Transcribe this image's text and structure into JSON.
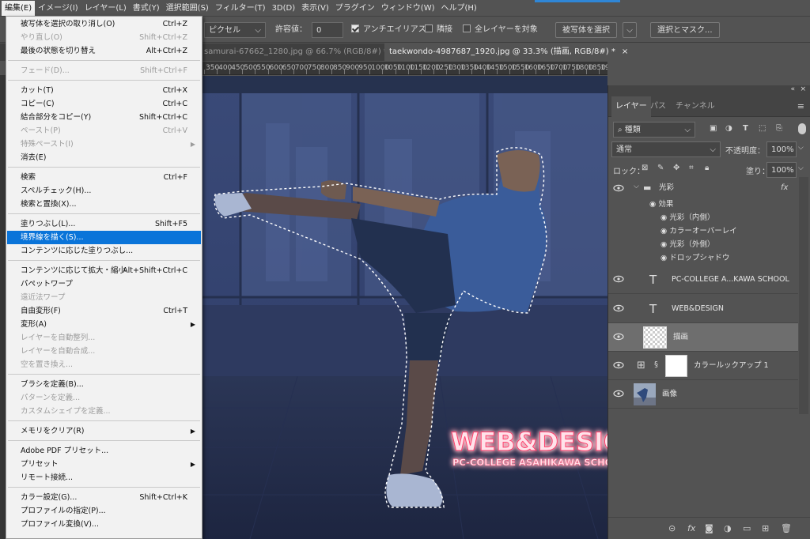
{
  "menubar": {
    "items": [
      "編集(E)",
      "イメージ(I)",
      "レイヤー(L)",
      "書式(Y)",
      "選択範囲(S)",
      "フィルター(T)",
      "3D(D)",
      "表示(V)",
      "プラグイン",
      "ウィンドウ(W)",
      "ヘルプ(H)"
    ]
  },
  "options": {
    "pixel_unit": "ピクセル",
    "tolerance_label": "許容値：",
    "tolerance_value": "0",
    "antialias_label": "アンチエイリアス",
    "contiguous_label": "隣接",
    "all_layers_label": "全レイヤーを対象",
    "select_subject": "被写体を選択",
    "select_mask": "選択とマスク..."
  },
  "tabs": [
    {
      "label": "samurai-67662_1280.jpg @ 66.7% (RGB/8#) *",
      "close": "×"
    },
    {
      "label": "taekwondo-4987687_1920.jpg @ 33.3% (描画, RGB/8#) *",
      "close": "×"
    }
  ],
  "ruler": [
    "350",
    "400",
    "450",
    "500",
    "550",
    "600",
    "650",
    "700",
    "750",
    "800",
    "850",
    "900",
    "950",
    "1000",
    "1050",
    "1100",
    "1150",
    "1200",
    "1250",
    "1300",
    "1350",
    "1400",
    "1450",
    "1500",
    "1550",
    "1600",
    "1650",
    "1700",
    "1750",
    "1800",
    "1850",
    "1900"
  ],
  "canvas": {
    "line1": "WEB&DESIGN",
    "line2": "PC-COLLEGE ASAHIKAWA SCHOOL"
  },
  "edit_menu": {
    "items": [
      {
        "label": "被写体を選択の取り消し(O)",
        "shortcut": "Ctrl+Z",
        "disabled": false
      },
      {
        "label": "やり直し(O)",
        "shortcut": "Shift+Ctrl+Z",
        "disabled": true
      },
      {
        "label": "最後の状態を切り替え",
        "shortcut": "Alt+Ctrl+Z",
        "disabled": false
      },
      {
        "sep": true
      },
      {
        "label": "フェード(D)...",
        "shortcut": "Shift+Ctrl+F",
        "disabled": true
      },
      {
        "sep": true
      },
      {
        "label": "カット(T)",
        "shortcut": "Ctrl+X",
        "disabled": false
      },
      {
        "label": "コピー(C)",
        "shortcut": "Ctrl+C",
        "disabled": false
      },
      {
        "label": "結合部分をコピー(Y)",
        "shortcut": "Shift+Ctrl+C",
        "disabled": false
      },
      {
        "label": "ペースト(P)",
        "shortcut": "Ctrl+V",
        "disabled": true
      },
      {
        "label": "特殊ペースト(I)",
        "shortcut": "",
        "submenu": true,
        "disabled": true
      },
      {
        "label": "消去(E)",
        "shortcut": "",
        "disabled": false
      },
      {
        "sep": true
      },
      {
        "label": "検索",
        "shortcut": "Ctrl+F",
        "disabled": false
      },
      {
        "label": "スペルチェック(H)...",
        "shortcut": "",
        "disabled": false
      },
      {
        "label": "検索と置換(X)...",
        "shortcut": "",
        "disabled": false
      },
      {
        "sep": true
      },
      {
        "label": "塗りつぶし(L)...",
        "shortcut": "Shift+F5",
        "disabled": false
      },
      {
        "label": "境界線を描く(S)...",
        "shortcut": "",
        "disabled": false,
        "highlighted": true
      },
      {
        "label": "コンテンツに応じた塗りつぶし...",
        "shortcut": "",
        "disabled": false
      },
      {
        "sep": true
      },
      {
        "label": "コンテンツに応じて拡大・縮小",
        "shortcut": "Alt+Shift+Ctrl+C",
        "disabled": false
      },
      {
        "label": "パペットワープ",
        "shortcut": "",
        "disabled": false
      },
      {
        "label": "遠近法ワープ",
        "shortcut": "",
        "disabled": true
      },
      {
        "label": "自由変形(F)",
        "shortcut": "Ctrl+T",
        "disabled": false
      },
      {
        "label": "変形(A)",
        "shortcut": "",
        "submenu": true,
        "disabled": false
      },
      {
        "label": "レイヤーを自動整列...",
        "shortcut": "",
        "disabled": true
      },
      {
        "label": "レイヤーを自動合成...",
        "shortcut": "",
        "disabled": true
      },
      {
        "label": "空を置き換え...",
        "shortcut": "",
        "disabled": true
      },
      {
        "sep": true
      },
      {
        "label": "ブラシを定義(B)...",
        "shortcut": "",
        "disabled": false
      },
      {
        "label": "パターンを定義...",
        "shortcut": "",
        "disabled": true
      },
      {
        "label": "カスタムシェイプを定義...",
        "shortcut": "",
        "disabled": true
      },
      {
        "sep": true
      },
      {
        "label": "メモリをクリア(R)",
        "shortcut": "",
        "submenu": true,
        "disabled": false
      },
      {
        "sep": true
      },
      {
        "label": "Adobe PDF プリセット...",
        "shortcut": "",
        "disabled": false
      },
      {
        "label": "プリセット",
        "shortcut": "",
        "submenu": true,
        "disabled": false
      },
      {
        "label": "リモート接続...",
        "shortcut": "",
        "disabled": false
      },
      {
        "sep": true
      },
      {
        "label": "カラー設定(G)...",
        "shortcut": "Shift+Ctrl+K",
        "disabled": false
      },
      {
        "label": "プロファイルの指定(P)...",
        "shortcut": "",
        "disabled": false
      },
      {
        "label": "プロファイル変換(V)...",
        "shortcut": "",
        "disabled": false
      }
    ]
  },
  "layers_panel": {
    "tabs": [
      "レイヤー",
      "パス",
      "チャンネル"
    ],
    "filter_kind": "種類",
    "blend_mode": "通常",
    "opacity_label": "不透明度：",
    "opacity_value": "100%",
    "lock_label": "ロック：",
    "fill_label": "塗り：",
    "fill_value": "100%",
    "group": {
      "name": "光彩",
      "fx": "fx",
      "effects_label": "効果",
      "effects": [
        "光彩（内側）",
        "カラーオーバーレイ",
        "光彩（外側）",
        "ドロップシャドウ"
      ]
    },
    "layers": [
      {
        "name": "PC-COLLEGE A...KAWA SCHOOL",
        "type": "text"
      },
      {
        "name": "WEB&DESIGN",
        "type": "text"
      },
      {
        "name": "描画",
        "type": "pixel",
        "selected": true
      },
      {
        "name": "カラールックアップ 1",
        "type": "adjustment"
      },
      {
        "name": "画像",
        "type": "image"
      }
    ]
  }
}
